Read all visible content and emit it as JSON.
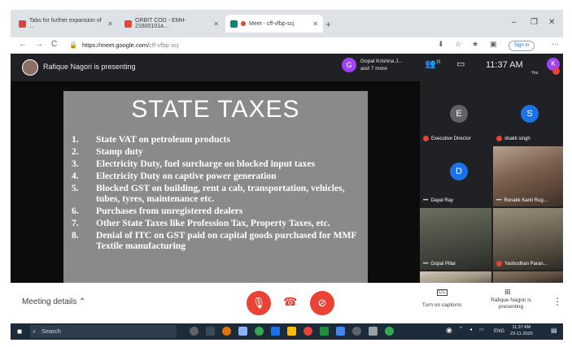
{
  "browser": {
    "tabs": [
      {
        "title": "Tabs for further expansion of …",
        "favicon_color": "#db4437",
        "active": false
      },
      {
        "title": "ORBIT COD - EMH-21800101a…",
        "favicon_color": "#ea4335",
        "active": false
      },
      {
        "title": "Meet - cff-vfbp-scj",
        "favicon_color": "#00897b",
        "active": true
      }
    ],
    "new_tab": "+",
    "window_controls": [
      "–",
      "❐",
      "✕"
    ],
    "nav": {
      "back": "←",
      "forward": "→",
      "reload": "C"
    },
    "url_host": "https://meet.google.com/",
    "url_path": "cff-vfbp-scj",
    "signin_label": "Sign in",
    "more": "⋯"
  },
  "meet": {
    "presenter_text": "Rafique Nagori is presenting",
    "group": {
      "initial": "G",
      "name": "Gopal Krishna J...",
      "more": "and 7 more"
    },
    "people_count": "10",
    "time": "11:37 AM",
    "you": {
      "initial": "K",
      "label": "You"
    }
  },
  "slide": {
    "title": "STATE TAXES",
    "items": [
      {
        "num": "1.",
        "text": "State VAT on petroleum products"
      },
      {
        "num": "2.",
        "text": "Stamp duty"
      },
      {
        "num": "3.",
        "text": "Electricity Duty, fuel surcharge on blocked input taxes"
      },
      {
        "num": "4.",
        "text": "Electricity Duty on captive power generation"
      },
      {
        "num": "5.",
        "text": "Blocked GST on building, rent a cab, transportation, vehicles, tubes, tyres, maintenance etc."
      },
      {
        "num": "6.",
        "text": "Purchases from unregistered dealers"
      },
      {
        "num": "7.",
        "text": "Other State Taxes like Profession Tax, Property Taxes, etc."
      },
      {
        "num": "8.",
        "text": "Denial of ITC on GST paid on capital goods purchased for MMF Textile manufacturing"
      }
    ]
  },
  "participants": [
    {
      "name": "Executive Director",
      "initial": "E",
      "avatar_color": "#5f6368",
      "muted": true
    },
    {
      "name": "shakti singh",
      "initial": "S",
      "avatar_color": "#1a73e8",
      "muted": true
    },
    {
      "name": "Dayal Ray",
      "initial": "D",
      "avatar_color": "#1a73e8",
      "muted": false
    },
    {
      "name": "Ronakk Kanti Rug...",
      "initial": "",
      "avatar_color": "",
      "muted": false
    },
    {
      "name": "Gopal Pillai",
      "initial": "",
      "avatar_color": "",
      "muted": false
    },
    {
      "name": "Yashodhan Paran...",
      "initial": "",
      "avatar_color": "",
      "muted": true
    }
  ],
  "controls": {
    "meeting_details": "Meeting details",
    "captions": "Turn on captions",
    "cc_icon": "CC",
    "presenting": "Rafique Nagori is presenting"
  },
  "taskbar": {
    "search": "Search",
    "lang": "ENG",
    "time": "11:37 AM",
    "date": "23-11-2020"
  },
  "colors": {
    "accent_red": "#ea4335",
    "accent_blue": "#1a73e8",
    "accent_purple": "#a142f4",
    "meet_dark": "#202124"
  }
}
